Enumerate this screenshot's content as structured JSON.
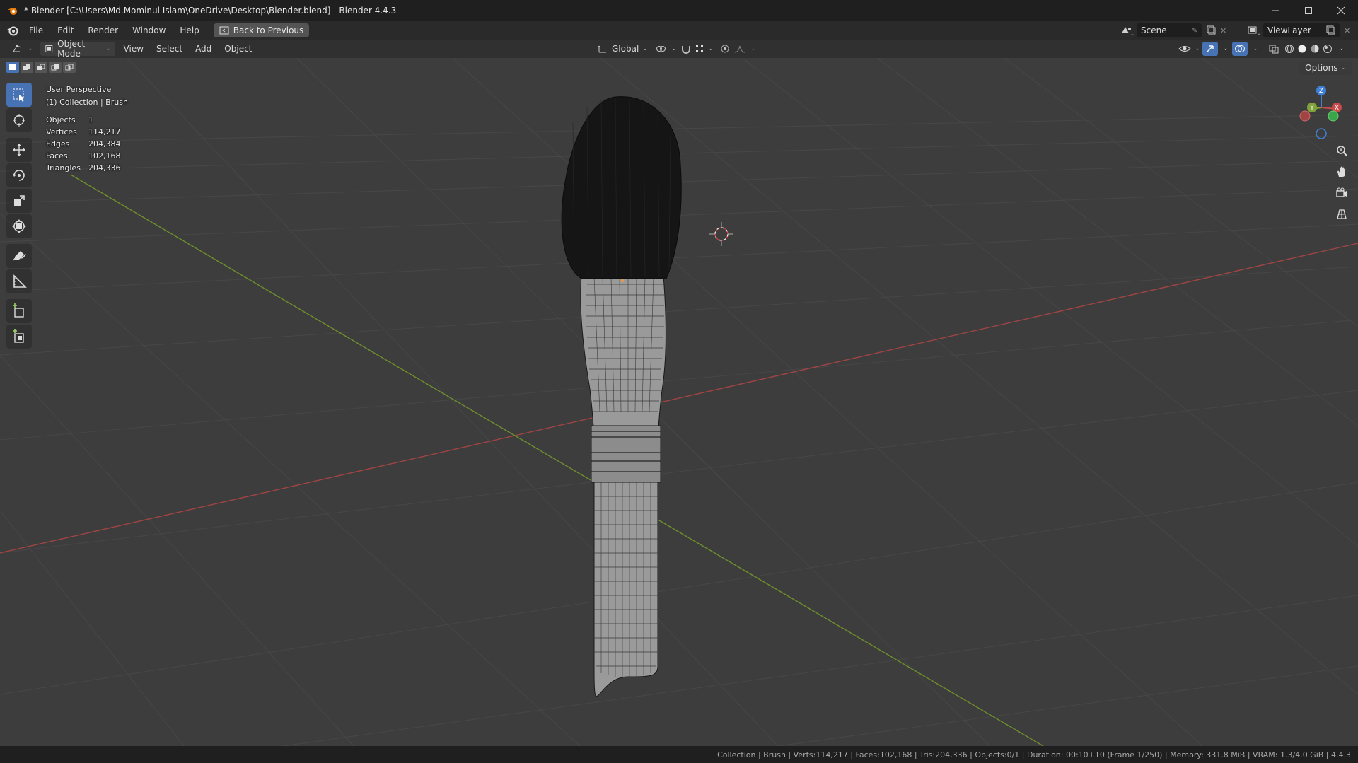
{
  "window": {
    "title": "* Blender [C:\\Users\\Md.Mominul Islam\\OneDrive\\Desktop\\Blender.blend] - Blender 4.4.3"
  },
  "menu": {
    "items": [
      "File",
      "Edit",
      "Render",
      "Window",
      "Help"
    ],
    "back_button": "Back to Previous"
  },
  "scene": {
    "label": "Scene"
  },
  "view_layer": {
    "label": "ViewLayer"
  },
  "viewport_header": {
    "mode": "Object Mode",
    "menus": [
      "View",
      "Select",
      "Add",
      "Object"
    ],
    "orientation": "Global"
  },
  "overlay": {
    "perspective": "User Perspective",
    "collection": "(1) Collection | Brush",
    "stats": [
      {
        "label": "Objects",
        "value": "1"
      },
      {
        "label": "Vertices",
        "value": "114,217"
      },
      {
        "label": "Edges",
        "value": "204,384"
      },
      {
        "label": "Faces",
        "value": "102,168"
      },
      {
        "label": "Triangles",
        "value": "204,336"
      }
    ]
  },
  "options": {
    "label": "Options"
  },
  "gizmo": {
    "x": "X",
    "y": "Y",
    "z": "Z"
  },
  "status_bar": {
    "text": "Collection | Brush | Verts:114,217 | Faces:102,168 | Tris:204,336 | Objects:0/1 | Duration: 00:10+10 (Frame 1/250) | Memory: 331.8 MiB | VRAM: 1.3/4.0 GiB | 4.4.3"
  },
  "colors": {
    "accent": "#4772b3",
    "x_axis": "#c84a4a",
    "y_axis": "#7fa23a",
    "z_axis": "#3f7fd6",
    "viewport_bg": "#3d3d3d"
  }
}
